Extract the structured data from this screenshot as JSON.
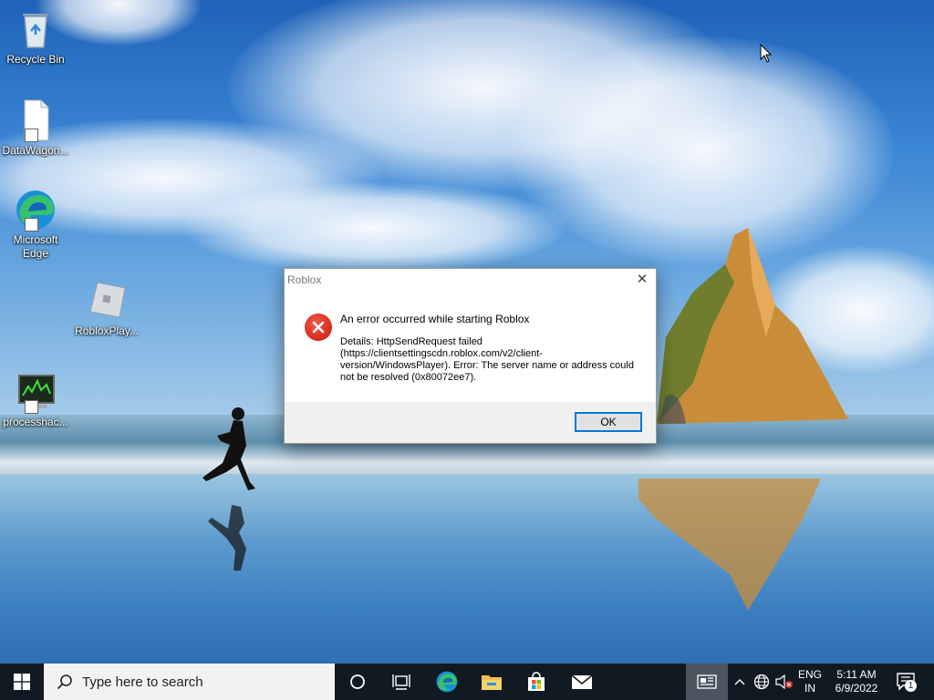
{
  "desktop": {
    "icons": [
      {
        "label": "Recycle Bin"
      },
      {
        "label": "DataWagon..."
      },
      {
        "label": "Microsoft Edge"
      },
      {
        "label": "RobloxPlay..."
      },
      {
        "label": "processhac..."
      }
    ]
  },
  "dialog": {
    "title": "Roblox",
    "heading": "An error occurred while starting Roblox",
    "details": "Details: HttpSendRequest failed (https://clientsettingscdn.roblox.com/v2/client-version/WindowsPlayer). Error: The server name or address could not be resolved (0x80072ee7).",
    "ok_label": "OK",
    "close_glyph": "✕"
  },
  "taskbar": {
    "search_placeholder": "Type here to search",
    "pinned": [
      "task-view-icon",
      "edge-icon",
      "file-explorer-icon",
      "microsoft-store-icon",
      "mail-icon"
    ],
    "language_top": "ENG",
    "language_bottom": "IN",
    "time": "5:11 AM",
    "date": "6/9/2022",
    "notification_count": "1"
  },
  "colors": {
    "taskbar_bg": "#111a22",
    "accent": "#0078d7",
    "error_red": "#d42a1c"
  }
}
